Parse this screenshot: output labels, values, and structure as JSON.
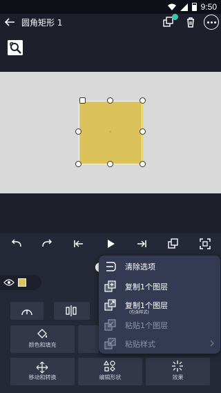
{
  "status_bar": {
    "time": "9:50"
  },
  "app_bar": {
    "title": "圆角矩形 1"
  },
  "canvas": {
    "shape_color": "#dcc25a",
    "canvas_bg": "#d9d9d9"
  },
  "panel_grid": [
    {
      "label": ""
    },
    {
      "label": ""
    },
    {
      "label": "颜色和填充"
    },
    {
      "label": ""
    },
    {
      "label": "移动和转换"
    },
    {
      "label": "编辑形状"
    },
    {
      "label": "效果"
    }
  ],
  "context_menu": {
    "items": [
      {
        "label": "清除选项",
        "sub": "",
        "enabled": true,
        "icon": "clear-selection-icon"
      },
      {
        "label": "复制1个图层",
        "sub": "",
        "enabled": true,
        "icon": "duplicate-layer-icon"
      },
      {
        "label": "复制1个图层",
        "sub": "(包含样式)",
        "enabled": true,
        "icon": "copy-layer-with-style-icon"
      },
      {
        "label": "粘贴1个图层",
        "sub": "",
        "enabled": false,
        "icon": "paste-layer-icon"
      },
      {
        "label": "粘贴样式",
        "sub": "",
        "enabled": false,
        "icon": "paste-style-icon"
      }
    ]
  },
  "colors": {
    "accent_badge": "#3fc2b0",
    "menu_bg": "#343a52",
    "panel_bg": "#252836"
  }
}
